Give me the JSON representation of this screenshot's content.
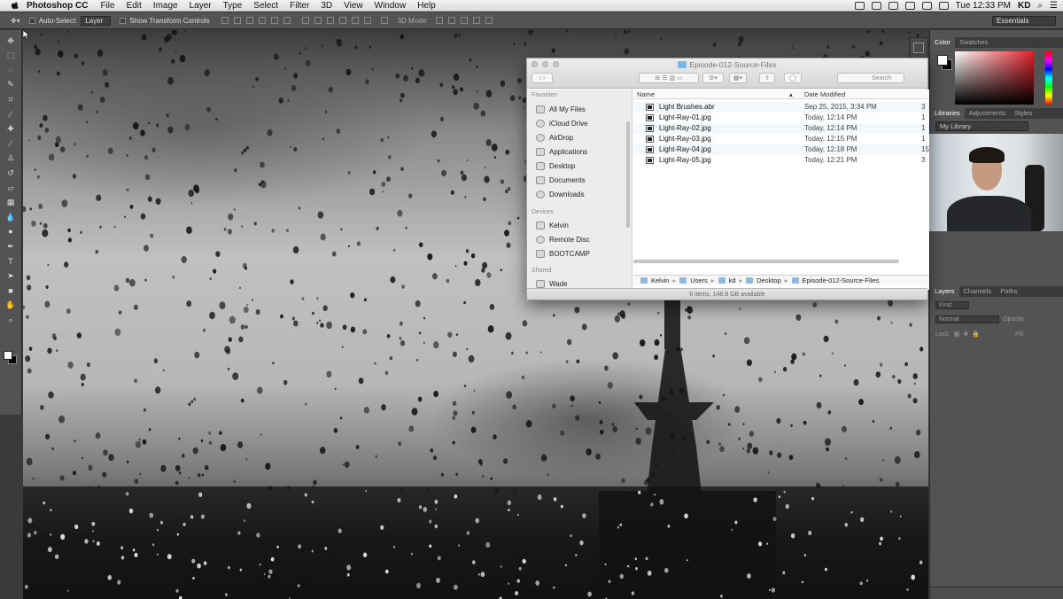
{
  "menubar": {
    "app_name": "Photoshop CC",
    "items": [
      "File",
      "Edit",
      "Image",
      "Layer",
      "Type",
      "Select",
      "Filter",
      "3D",
      "View",
      "Window",
      "Help"
    ],
    "clock": "Tue 12:33 PM",
    "user": "KD"
  },
  "options_bar": {
    "auto_select_label": "Auto-Select:",
    "auto_select_value": "Layer",
    "show_transform_label": "Show Transform Controls",
    "mode_3d_label": "3D Mode:",
    "workspace": "Essentials"
  },
  "right_panels": {
    "color_tabs": [
      "Color",
      "Swatches"
    ],
    "library_tabs": [
      "Libraries",
      "Adjustments",
      "Styles"
    ],
    "library_select": "My Library",
    "layers_tabs": [
      "Layers",
      "Channels",
      "Paths"
    ],
    "kind_label": "Kind",
    "blend_mode": "Normal",
    "opacity_label": "Opacity:",
    "lock_label": "Lock:",
    "fill_label": "Fill:"
  },
  "finder": {
    "title": "Episode-012-Source-Files",
    "search_placeholder": "Search",
    "sidebar": {
      "favorites_label": "Favorites",
      "favorites": [
        "All My Files",
        "iCloud Drive",
        "AirDrop",
        "Applications",
        "Desktop",
        "Documents",
        "Downloads"
      ],
      "devices_label": "Devices",
      "devices": [
        "Kelvin",
        "Remote Disc",
        "BOOTCAMP"
      ],
      "shared_label": "Shared",
      "shared": [
        "Wade"
      ]
    },
    "columns": {
      "name": "Name",
      "date": "Date Modified"
    },
    "files": [
      {
        "name": "Light Brushes.abr",
        "date": "Sep 25, 2015, 3:34 PM",
        "size": "3"
      },
      {
        "name": "Light-Ray-01.jpg",
        "date": "Today, 12:14 PM",
        "size": "1"
      },
      {
        "name": "Light-Ray-02.jpg",
        "date": "Today, 12:14 PM",
        "size": "1"
      },
      {
        "name": "Light-Ray-03.jpg",
        "date": "Today, 12:15 PM",
        "size": "1"
      },
      {
        "name": "Light-Ray-04.jpg",
        "date": "Today, 12:18 PM",
        "size": "15"
      },
      {
        "name": "Light-Ray-05.jpg",
        "date": "Today, 12:21 PM",
        "size": "3"
      }
    ],
    "path": [
      "Kelvin",
      "Users",
      "kd",
      "Desktop",
      "Episode-012-Source-Files"
    ],
    "status": "6 items, 148.9 GB available"
  }
}
